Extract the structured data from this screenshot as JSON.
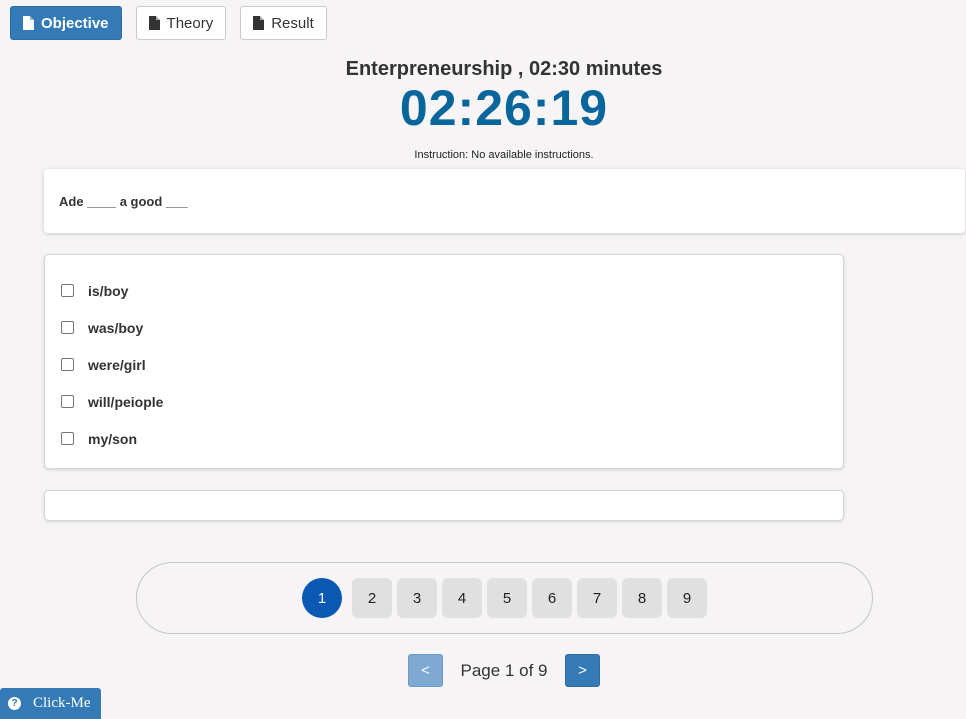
{
  "tabs": [
    {
      "label": "Objective",
      "icon": "file-icon",
      "active": true
    },
    {
      "label": "Theory",
      "icon": "file-icon",
      "active": false
    },
    {
      "label": "Result",
      "icon": "file-icon",
      "active": false
    }
  ],
  "header": {
    "subject": "Enterpreneurship , 02:30 minutes",
    "timer": "02:26:19",
    "instruction": "Instruction: No available instructions."
  },
  "question": {
    "text": "Ade ____ a good ___"
  },
  "options": [
    {
      "label": "is/boy",
      "checked": false
    },
    {
      "label": "was/boy",
      "checked": false
    },
    {
      "label": "were/girl",
      "checked": false
    },
    {
      "label": "will/peiople",
      "checked": false
    },
    {
      "label": "my/son",
      "checked": false
    }
  ],
  "pagination": {
    "pages": [
      "1",
      "2",
      "3",
      "4",
      "5",
      "6",
      "7",
      "8",
      "9"
    ],
    "current": "1",
    "prev_label": "<",
    "next_label": ">",
    "page_info": "Page 1 of 9"
  },
  "help": {
    "label": "Click-Me",
    "icon": "question-circle-icon"
  },
  "colors": {
    "accent": "#337ab7",
    "timer": "#08669c",
    "active_page": "#0a57b4"
  }
}
